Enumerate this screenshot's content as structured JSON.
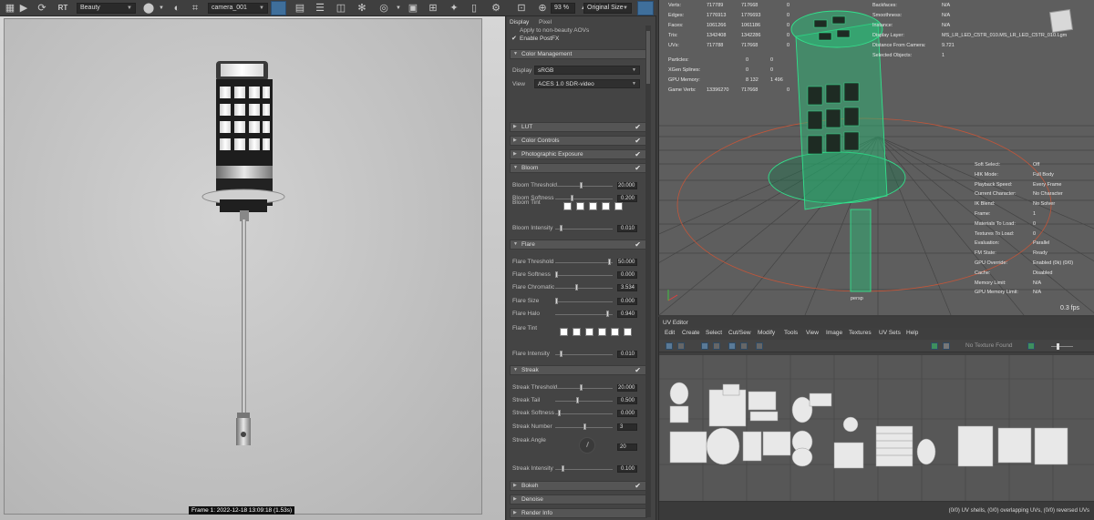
{
  "toolbar": {
    "aov": "Beauty",
    "camera": "camera_001",
    "zoom": "93 %",
    "size_mode": "Original Size",
    "rt_label": "RT"
  },
  "render": {
    "frame_label": "Frame  1:  2022-12-18  13:09:18  (1.53s)"
  },
  "panel": {
    "tabs": [
      "Display",
      "Pixel"
    ],
    "apply_aovs": "Apply to non-beauty AOVs",
    "enable_postfx": "Enable PostFX",
    "color_mgmt": "Color Management",
    "display_label": "Display",
    "display_value": "sRGB",
    "view_label": "View",
    "view_value": "ACES 1.0 SDR-video",
    "lut": "LUT",
    "color_controls": "Color Controls",
    "photo_exposure": "Photographic Exposure",
    "bloom": {
      "title": "Bloom",
      "threshold_label": "Bloom Threshold",
      "threshold": "20.000",
      "threshold_pos": 0.45,
      "softness_label": "Bloom Softness",
      "softness": "0.200",
      "softness_pos": 0.28,
      "tint_label": "Bloom Tint",
      "intensity_label": "Bloom Intensity",
      "intensity": "0.010",
      "intensity_pos": 0.08
    },
    "flare": {
      "title": "Flare",
      "threshold_label": "Flare Threshold",
      "threshold": "50.000",
      "threshold_pos": 0.97,
      "softness_label": "Flare Softness",
      "softness": "0.000",
      "softness_pos": 0.0,
      "chromatic_label": "Flare Chromatic",
      "chromatic": "3.534",
      "chromatic_pos": 0.36,
      "size_label": "Flare Size",
      "size": "0.000",
      "size_pos": 0.0,
      "halo_label": "Flare Halo",
      "halo": "0.940",
      "halo_pos": 0.94,
      "tint_label": "Flare Tint",
      "intensity_label": "Flare Intensity",
      "intensity": "0.010",
      "intensity_pos": 0.08
    },
    "streak": {
      "title": "Streak",
      "threshold_label": "Streak Threshold",
      "threshold": "20.000",
      "threshold_pos": 0.45,
      "tail_label": "Streak Tail",
      "tail": "0.500",
      "tail_pos": 0.38,
      "softness_label": "Streak Softness",
      "softness": "0.000",
      "softness_pos": 0.05,
      "number_label": "Streak Number",
      "number": "3",
      "number_pos": 0.52,
      "angle_label": "Streak Angle",
      "angle": "20",
      "intensity_label": "Streak Intensity",
      "intensity": "0.100",
      "intensity_pos": 0.12
    },
    "bokeh": "Bokeh",
    "denoise": "Denoise",
    "render_info": "Render Info"
  },
  "hud_left": {
    "rows": [
      {
        "k": "Verts:",
        "a": "717789",
        "b": "717668",
        "c": "0"
      },
      {
        "k": "Edges:",
        "a": "1776913",
        "b": "1776693",
        "c": "0"
      },
      {
        "k": "Faces:",
        "a": "1061266",
        "b": "1061186",
        "c": "0"
      },
      {
        "k": "Tris:",
        "a": "1342408",
        "b": "1342286",
        "c": "0"
      },
      {
        "k": "UVs:",
        "a": "717788",
        "b": "717668",
        "c": "0"
      }
    ],
    "particles": {
      "k": "Particles:",
      "a": "0",
      "b": "0"
    },
    "xgen": {
      "k": "XGen Splines:",
      "a": "0",
      "b": "0"
    },
    "gpu": {
      "k": "GPU Memory:",
      "a": "8 132",
      "b": "1 496"
    },
    "game": {
      "k": "Game Verts:",
      "a": "13396270",
      "b": "717668",
      "c": "0"
    }
  },
  "hud_right_top": [
    {
      "k": "Backfaces:",
      "v": "N/A"
    },
    {
      "k": "Smoothness:",
      "v": "N/A"
    },
    {
      "k": "Instance:",
      "v": "N/A"
    },
    {
      "k": "Display Layer:",
      "v": "MS_LR_LED_C5TR_010.MS_LR_LED_C5TR_010.Lgm"
    },
    {
      "k": "Distance From Camera:",
      "v": "9.721"
    },
    {
      "k": "Selected Objects:",
      "v": "1"
    }
  ],
  "hud_right_bottom": [
    {
      "k": "Soft Select:",
      "v": "Off"
    },
    {
      "k": "HIK Mode:",
      "v": "Full Body"
    },
    {
      "k": "Playback Speed:",
      "v": "Every Frame"
    },
    {
      "k": "Current Character:",
      "v": "No Character"
    },
    {
      "k": "IK Blend:",
      "v": "No Solver"
    },
    {
      "k": "Frame:",
      "v": "1"
    },
    {
      "k": "Materials To Load:",
      "v": "0"
    },
    {
      "k": "Textures To Load:",
      "v": "0"
    },
    {
      "k": "Evaluation:",
      "v": "Parallel"
    },
    {
      "k": "FM State:",
      "v": "Ready"
    },
    {
      "k": "GPU Override:",
      "v": "Enabled (0k) (0/0)"
    },
    {
      "k": "Cache:",
      "v": "Disabled"
    },
    {
      "k": "Memory Limit:",
      "v": "N/A"
    },
    {
      "k": "GPU Memory Limit:",
      "v": "N/A"
    }
  ],
  "persp": {
    "camera_label": "persp",
    "fps": "0.3 fps"
  },
  "uv_editor": {
    "title": "UV Editor",
    "menu": [
      "Edit",
      "Create",
      "Select",
      "Cut/Sew",
      "Modify",
      "Tools",
      "View",
      "Image",
      "Textures",
      "UV Sets",
      "Help"
    ],
    "texture_status": "No Texture Found",
    "status": "(0/0) UV shells, (0/0) overlapping UVs, (0/0) reversed UVs"
  },
  "colors": {
    "wire": "#33e08c",
    "grid": "#4a4a4a",
    "panel": "#444444",
    "accent": "#3f6f9b"
  }
}
